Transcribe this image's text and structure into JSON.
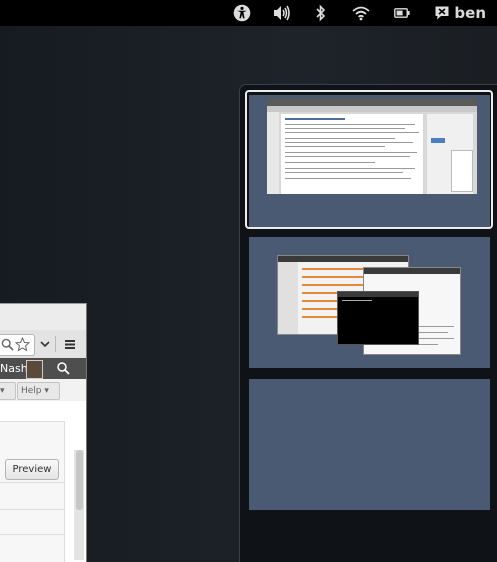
{
  "top_bar": {
    "icons": [
      "accessibility-icon",
      "volume-icon",
      "bluetooth-icon",
      "wifi-icon",
      "battery-icon",
      "chat-status-icon"
    ],
    "user_name": "ben"
  },
  "browser_window": {
    "user_label": "Nash",
    "help_label": "Help",
    "preview_label": "Preview"
  },
  "workspaces": [
    {
      "name": "workspace-1",
      "active": true
    },
    {
      "name": "workspace-2",
      "active": false
    },
    {
      "name": "workspace-3",
      "active": false
    }
  ],
  "colors": {
    "top_bar": "#000000",
    "desktop": "#1b1f24",
    "workspace": "#4a5a73",
    "active_outline": "#ececec"
  }
}
